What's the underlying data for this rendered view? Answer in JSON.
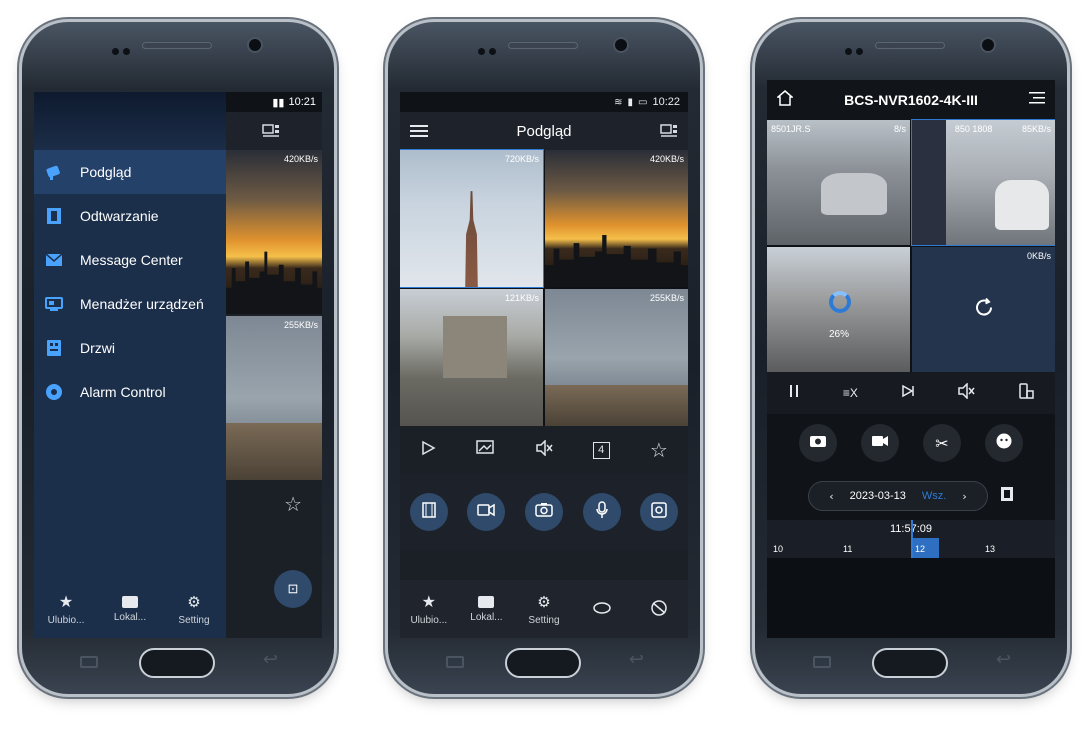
{
  "phone1": {
    "status": {
      "time": "10:21"
    },
    "menu": [
      {
        "label": "Podgląd",
        "icon": "camera-icon",
        "active": true
      },
      {
        "label": "Odtwarzanie",
        "icon": "film-icon"
      },
      {
        "label": "Message Center",
        "icon": "envelope-icon"
      },
      {
        "label": "Menadżer urządzeń",
        "icon": "device-manager-icon"
      },
      {
        "label": "Drzwi",
        "icon": "door-icon"
      },
      {
        "label": "Alarm Control",
        "icon": "alarm-icon"
      }
    ],
    "tiles": [
      {
        "rate": "420KB/s"
      },
      {
        "rate": "255KB/s"
      }
    ],
    "tabs": [
      {
        "label": "Ulubio...",
        "icon": "star-icon"
      },
      {
        "label": "Lokal...",
        "icon": "folder-icon"
      },
      {
        "label": "Setting",
        "icon": "gear-icon"
      }
    ]
  },
  "phone2": {
    "status": {
      "time": "10:22"
    },
    "title": "Podgląd",
    "tiles": [
      {
        "rate": "720KB/s"
      },
      {
        "rate": "420KB/s"
      },
      {
        "rate": "121KB/s"
      },
      {
        "rate": "255KB/s"
      }
    ],
    "toolbar": [
      {
        "icon": "play-icon"
      },
      {
        "icon": "image-quality-icon"
      },
      {
        "icon": "mute-icon"
      },
      {
        "icon": "split-4-icon",
        "label": "4"
      },
      {
        "icon": "star-icon"
      }
    ],
    "actions": [
      {
        "icon": "playback-icon"
      },
      {
        "icon": "record-icon"
      },
      {
        "icon": "snapshot-icon"
      },
      {
        "icon": "microphone-icon"
      },
      {
        "icon": "ptz-icon"
      }
    ],
    "tabs": [
      {
        "label": "Ulubio...",
        "icon": "star-icon"
      },
      {
        "label": "Lokal...",
        "icon": "folder-icon"
      },
      {
        "label": "Setting",
        "icon": "gear-icon"
      },
      {
        "label": "",
        "icon": "ptz-rotate-icon"
      },
      {
        "label": "",
        "icon": "no-ptz-icon"
      }
    ]
  },
  "phone3": {
    "title": "BCS-NVR1602-4K-III",
    "tiles": [
      {
        "label": "8501JR.S",
        "rate": "8/s"
      },
      {
        "label": "850 1808",
        "rate": "85KB/s"
      },
      {
        "progress": "26%"
      },
      {
        "rate": "0KB/s"
      }
    ],
    "controls": [
      {
        "icon": "pause-icon"
      },
      {
        "icon": "speed-icon",
        "label": "≡X"
      },
      {
        "icon": "next-frame-icon"
      },
      {
        "icon": "mute-icon"
      },
      {
        "icon": "rotate-screen-icon"
      }
    ],
    "actions": [
      {
        "icon": "camera-icon"
      },
      {
        "icon": "video-icon"
      },
      {
        "icon": "scissors-icon"
      },
      {
        "icon": "face-icon"
      }
    ],
    "date": "2023-03-13",
    "date_tag": "Wsz.",
    "timeline": {
      "current": "11:57:09",
      "ticks": [
        "10",
        "11",
        "12",
        "13"
      ]
    }
  }
}
